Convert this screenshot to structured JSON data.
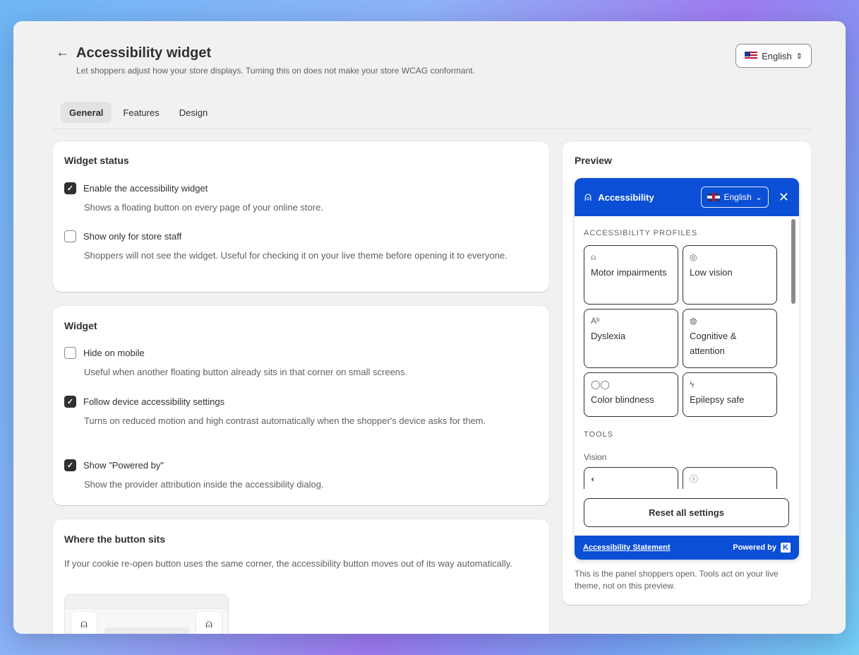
{
  "header": {
    "title": "Accessibility widget",
    "subtitle": "Let shoppers adjust how your store displays. Turning this on does not make your store WCAG conformant.",
    "language": "English"
  },
  "tabs": [
    {
      "label": "General",
      "active": true
    },
    {
      "label": "Features",
      "active": false
    },
    {
      "label": "Design",
      "active": false
    }
  ],
  "widget_status": {
    "title": "Widget status",
    "options": [
      {
        "label": "Enable the accessibility widget",
        "checked": true,
        "description": "Shows a floating button on every page of your online store."
      },
      {
        "label": "Show only for store staff",
        "checked": false,
        "description": "Shoppers will not see the widget. Useful for checking it on your live theme before opening it to everyone."
      }
    ]
  },
  "widget": {
    "title": "Widget",
    "options": [
      {
        "label": "Hide on mobile",
        "checked": false,
        "description": "Useful when another floating button already sits in that corner on small screens."
      },
      {
        "label": "Follow device accessibility settings",
        "checked": true,
        "description": "Turns on reduced motion and high contrast automatically when the shopper's device asks for them."
      },
      {
        "label": "Show \"Powered by\"",
        "checked": true,
        "description": "Show the provider attribution inside the accessibility dialog."
      }
    ]
  },
  "placement": {
    "title": "Where the button sits",
    "description": "If your cookie re-open button uses the same corner, the accessibility button moves out of its way automatically."
  },
  "preview": {
    "title": "Preview",
    "panel_title": "Accessibility",
    "panel_language": "English",
    "profiles_label": "ACCESSIBILITY PROFILES",
    "profiles": [
      {
        "label": "Motor impairments",
        "icon": "person-icon"
      },
      {
        "label": "Low vision",
        "icon": "eye-icon"
      },
      {
        "label": "Dyslexia",
        "icon": "text-icon"
      },
      {
        "label": "Cognitive & attention",
        "icon": "brain-icon"
      },
      {
        "label": "Color blindness",
        "icon": "circles-icon"
      },
      {
        "label": "Epilepsy safe",
        "icon": "bolt-icon"
      }
    ],
    "tools_label": "TOOLS",
    "vision_label": "Vision",
    "reset_label": "Reset all settings",
    "statement_label": "Accessibility Statement",
    "powered_label": "Powered by",
    "note": "This is the panel shoppers open. Tools act on your live theme, not on this preview."
  },
  "colors": {
    "accent": "#0a4fd6",
    "background": "#f1f1f1"
  }
}
